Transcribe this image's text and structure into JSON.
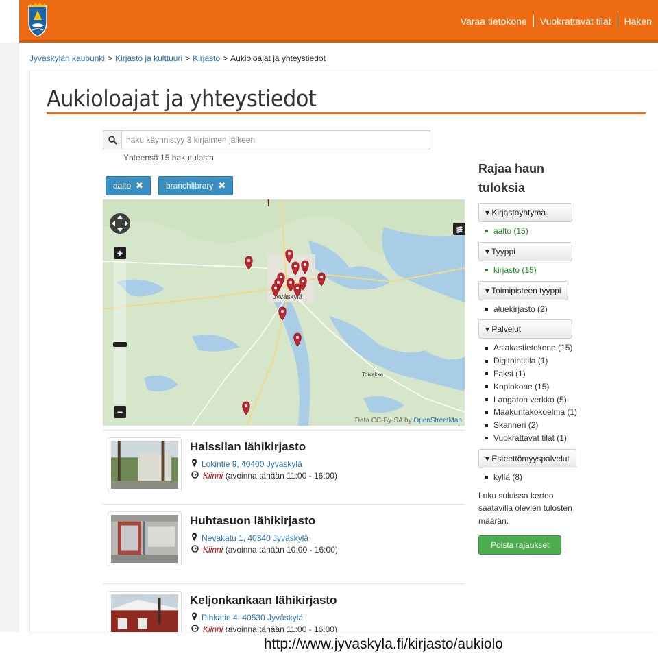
{
  "header": {
    "nav": [
      "Varaa tietokone",
      "Vuokrattavat tilat",
      "Haken"
    ]
  },
  "breadcrumb": {
    "items": [
      "Jyväskylän kaupunki",
      "Kirjasto ja kulttuuri",
      "Kirjasto"
    ],
    "current": "Aukioloajat ja yhteystiedot"
  },
  "page": {
    "title": "Aukioloajat ja yhteystiedot"
  },
  "search": {
    "placeholder": "haku käynnistyy 3 kirjaimen jälkeen",
    "value": "",
    "result_count": "Yhteensä 15 hakutulosta"
  },
  "filters": [
    {
      "label": "aalto"
    },
    {
      "label": "branchlibrary"
    }
  ],
  "map": {
    "labels": {
      "city": "Jyväskylä",
      "town": "Toivakka"
    },
    "credit": "Data CC-By-SA by",
    "credit_link": "OpenStreetMap"
  },
  "results": [
    {
      "name": "Halssilan lähikirjasto",
      "address": "Lokintie 9, 40400 Jyväskylä",
      "status": "Kiinni",
      "hours": "(avoinna tänään 11:00 - 16:00)"
    },
    {
      "name": "Huhtasuon lähikirjasto",
      "address": "Nevakatu 1, 40340 Jyväskylä",
      "status": "Kiinni",
      "hours": "(avoinna tänään 10:00 - 16:00)"
    },
    {
      "name": "Keljonkankaan lähikirjasto",
      "address": "Pihkatie 4, 40530 Jyväskylä",
      "status": "Kiinni",
      "hours": "(avoinna tänään 11:00 - 16:00)"
    }
  ],
  "sidebar": {
    "title_line1": "Rajaa haun",
    "title_line2": "tuloksia",
    "facets": [
      {
        "label": "▾ Kirjastoyhtymä",
        "items": [
          {
            "text": "aalto (15)",
            "active": true
          }
        ]
      },
      {
        "label": "▾ Tyyppi",
        "items": [
          {
            "text": "kirjasto (15)",
            "active": true
          }
        ]
      },
      {
        "label": "▾ Toimipisteen tyyppi",
        "items": [
          {
            "text": "aluekirjasto (2)",
            "active": false
          }
        ]
      },
      {
        "label": "▾ Palvelut",
        "items": [
          {
            "text": "Asiakastietokone (15)",
            "active": false
          },
          {
            "text": "Digitointitila (1)",
            "active": false
          },
          {
            "text": "Faksi (1)",
            "active": false
          },
          {
            "text": "Kopiokone (15)",
            "active": false
          },
          {
            "text": "Langaton verkko (5)",
            "active": false
          },
          {
            "text": "Maakuntakokoelma (1)",
            "active": false
          },
          {
            "text": "Skanneri (2)",
            "active": false
          },
          {
            "text": "Vuokrattavat tilat (1)",
            "active": false
          }
        ]
      },
      {
        "label": "▾ Esteettömyyspalvelut",
        "items": [
          {
            "text": "kyllä (8)",
            "active": false
          }
        ]
      }
    ],
    "note_lines": [
      "Luku suluissa kertoo",
      "saatavilla olevien tulosten",
      "määrän."
    ],
    "clear_button": "Poista rajaukset"
  },
  "colors": {
    "brand_orange": "#ec6a12",
    "link_blue": "#1f6fb4",
    "tag_blue": "#3b8ec0",
    "active_green": "#1a8a1a",
    "button_green": "#4cae4c",
    "closed_red": "#cc0000",
    "marker_red": "#c0262d"
  },
  "footer": {
    "url": "http://www.jyvaskyla.fi/kirjasto/aukiolo"
  }
}
